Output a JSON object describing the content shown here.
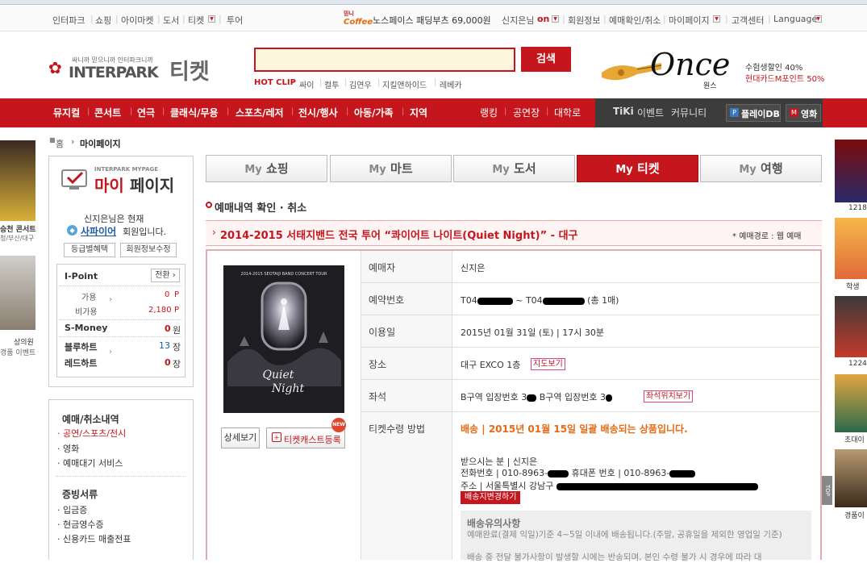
{
  "topbar": {
    "links": [
      "인터파크",
      "쇼핑",
      "아이마켓",
      "도서",
      "티켓",
      "투어"
    ],
    "promo_badge": "Coffee",
    "promo_badge_small": "믿니",
    "promo_text": "노스페이스 패딩부츠 69,000원",
    "user_name": "신지은님",
    "status": "on",
    "user_links": [
      "회원정보",
      "예매확인/취소",
      "마이페이지",
      "고객센터",
      "Language"
    ]
  },
  "header": {
    "slogan": "싸니까 믿으니까 인터파크니까",
    "logo_text": "INTERPARK",
    "logo_ticket": "티켓",
    "search_button": "검색",
    "search_value": "",
    "hotclip_label": "HOT CLIP",
    "hotclip_items": [
      "싸이",
      "컬투",
      "김연우",
      "지킬앤하이드",
      "레베카"
    ],
    "banner_logo": "Once",
    "banner_sub": "원스",
    "banner_line1": "수험생할인 40%",
    "banner_line2": "현대카드M포인트 50%"
  },
  "nav": {
    "items": [
      "뮤지컬",
      "콘서트",
      "연극",
      "클래식/무용",
      "스포츠/레저",
      "전시/행사",
      "아동/가족",
      "지역",
      "랭킹",
      "공연장",
      "대학로"
    ],
    "dark_items": [
      "TiKi",
      "이벤트",
      "커뮤니티"
    ],
    "playdb": "플레이DB",
    "movie": "영화",
    "playdb_badge": "P",
    "movie_badge": "M"
  },
  "breadcrumb": {
    "home": "홈",
    "current": "마이페이지"
  },
  "left_ads": {
    "item1": "승천 콘서트",
    "item1_sub": "청/부산/대구",
    "item2": "상의원",
    "item2_sub": "경품 이벤트"
  },
  "mypage": {
    "header_small": "INTERPARK MYPAGE",
    "header_my": "마이",
    "header_page": "페이지",
    "user_line": "신지은님은 현재",
    "grade": "사파이어",
    "grade_suffix": "회원입니다.",
    "btn_benefit": "등급별혜택",
    "btn_edit": "회원정보수정",
    "ipoint_label": "I-Point",
    "convert": "전환",
    "available_label": "가용",
    "available_value": "0",
    "unavailable_label": "비가용",
    "unavailable_value": "2,180",
    "point_unit": "P",
    "smoney_label": "S-Money",
    "smoney_value": "0",
    "smoney_unit": "원",
    "blue_heart_label": "블루하트",
    "blue_heart_value": "13",
    "red_heart_label": "레드하트",
    "red_heart_value": "0",
    "heart_unit": "장"
  },
  "leftmenu": {
    "section1_title": "예매/취소내역",
    "section1_items": [
      "공연/스포츠/전시",
      "영화",
      "예매대기 서비스"
    ],
    "section2_title": "증빙서류",
    "section2_items": [
      "입금증",
      "현금영수증",
      "신용카드 매출전표"
    ]
  },
  "tabs": [
    {
      "my": "My",
      "label": "쇼핑"
    },
    {
      "my": "My",
      "label": "마트"
    },
    {
      "my": "My",
      "label": "도서"
    },
    {
      "my": "My",
      "label": "티켓"
    },
    {
      "my": "My",
      "label": "여행"
    }
  ],
  "section": {
    "title": "예매내역 확인 · 취소",
    "event_title": "2014-2015 서태지밴드 전국 투어 “콰이어트 나이트(Quiet Night)” - 대구",
    "route_label": "예매경로 : 웹 예매"
  },
  "poster": {
    "top_text": "2014-2015 SEOTAIJI BAND CONCERT TOUR",
    "title_line1": "Quiet",
    "title_line2": "Night",
    "detail_button": "상세보기",
    "register_button": "티켓캐스트등록",
    "new_badge": "NEW"
  },
  "detail": {
    "booker_label": "예매자",
    "booker_value": "신지은",
    "booking_no_label": "예약번호",
    "booking_no_a": "T04",
    "booking_no_sep": "~",
    "booking_no_b": "T04",
    "booking_count": "(총 1매)",
    "date_label": "이용일",
    "date_value": "2015년 01월 31일 (토) | 17시 30분",
    "venue_label": "장소",
    "venue_value": "대구 EXCO 1층",
    "venue_map_button": "지도보기",
    "seat_label": "좌석",
    "seat_a": "B구역 입장번호 3",
    "seat_b": "B구역 입장번호 3",
    "seat_button": "좌석위치보기",
    "delivery_label": "티켓수령 방법",
    "delivery_value": "배송 | 2015년 01월 15일 일괄 배송되는 상품입니다.",
    "receiver_line": "받으시는 분 | 신지은",
    "phone_label": "전화번호 | 010-8963-",
    "mobile_label": "휴대폰 번호 | 010-8963-",
    "address_label": "주소 | 서울특별시 강남구",
    "change_address_button": "배송지변경하기",
    "notice_title": "배송유의사항",
    "notice_line1": "예매완료(결제 익일)기준 4~5일 이내에 배송됩니다.(주말, 공휴일을 제외한 영업일 기준)",
    "notice_line2": "배송 중 전달 불가사항이 발생할 시에는 반송되며, 본인 수령 불가 시 경우에 따라 대"
  },
  "right_ads": {
    "num1": "1218",
    "item2": "학생",
    "num3": "1224",
    "item4": "초대이",
    "item5": "경품이",
    "top_button": "TOP"
  }
}
